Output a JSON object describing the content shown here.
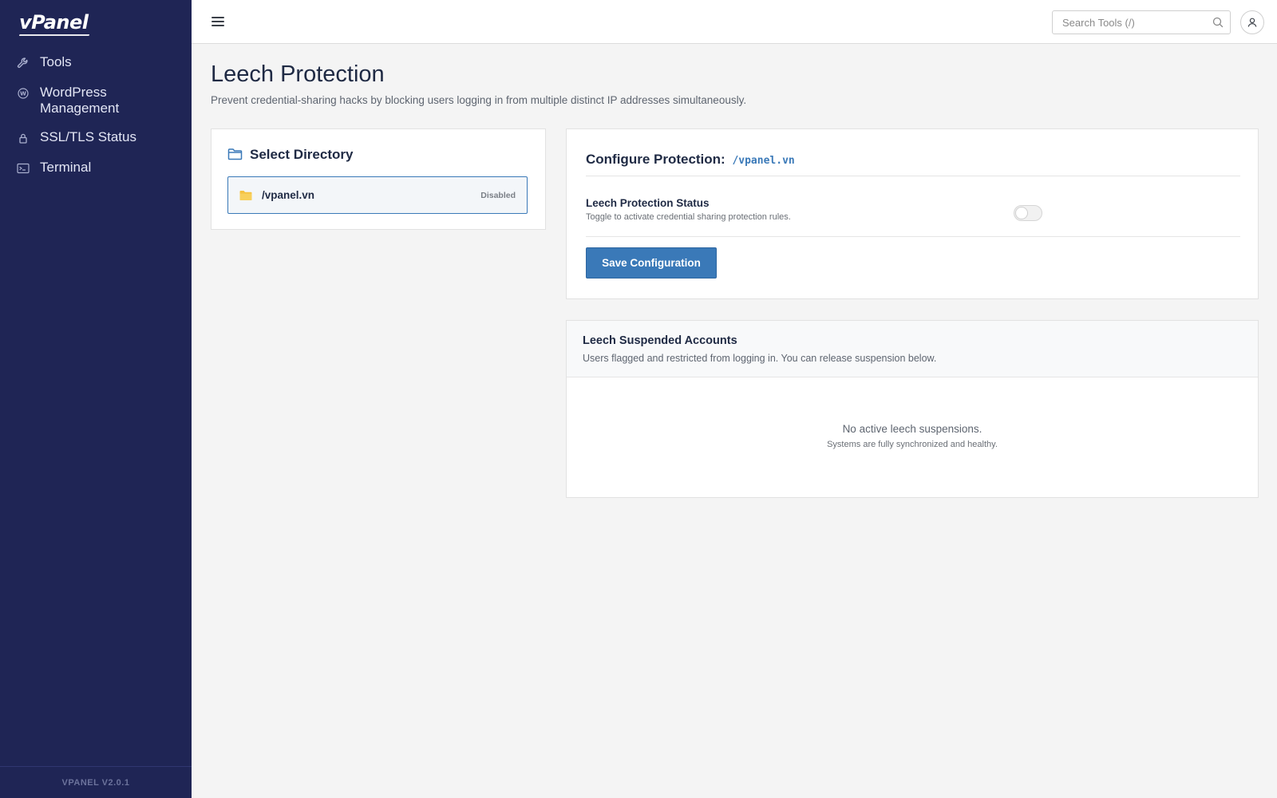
{
  "app": {
    "logo": "vPanel",
    "version": "VPANEL V2.0.1"
  },
  "sidebar": {
    "items": [
      {
        "label": "Tools",
        "icon": "wrench-icon"
      },
      {
        "label": "WordPress Management",
        "icon": "wordpress-icon"
      },
      {
        "label": "SSL/TLS Status",
        "icon": "lock-icon"
      },
      {
        "label": "Terminal",
        "icon": "terminal-icon"
      }
    ]
  },
  "topbar": {
    "search_placeholder": "Search Tools (/)",
    "icons": [
      "menu-icon",
      "search-icon",
      "user-icon"
    ]
  },
  "page": {
    "title": "Leech Protection",
    "description": "Prevent credential-sharing hacks by blocking users logging in from multiple distinct IP addresses simultaneously."
  },
  "directory": {
    "heading": "Select Directory",
    "items": [
      {
        "path": "/vpanel.vn",
        "status": "Disabled",
        "selected": true
      }
    ]
  },
  "config": {
    "title": "Configure Protection:",
    "path": "/vpanel.vn",
    "status_label": "Leech Protection Status",
    "status_help": "Toggle to activate credential sharing protection rules.",
    "enabled": false,
    "save_label": "Save Configuration"
  },
  "suspended": {
    "title": "Leech Suspended Accounts",
    "description": "Users flagged and restricted from logging in. You can release suspension below.",
    "empty_title": "No active leech suspensions.",
    "empty_subtitle": "Systems are fully synchronized and healthy."
  },
  "colors": {
    "sidebar_bg": "#1f2555",
    "accent": "#3a79b8",
    "page_bg": "#f4f4f4",
    "folder": "#f5c242"
  }
}
